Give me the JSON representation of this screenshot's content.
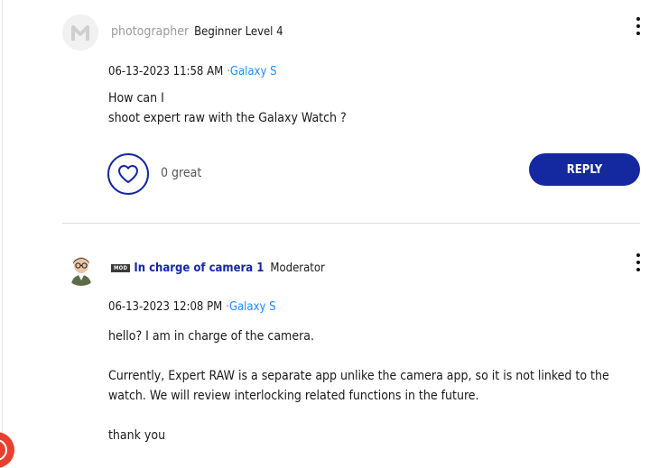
{
  "posts": [
    {
      "username": "photographer",
      "rank": "Beginner Level 4",
      "date": "06-13-2023 11:58 AM",
      "separator": "·",
      "board": "Galaxy S",
      "body": [
        "How can I",
        "shoot expert raw with the Galaxy Watch ?"
      ],
      "likes": "0 great",
      "reply_label": "REPLY",
      "avatar_initial": "M"
    },
    {
      "badge": "MOD",
      "username": "In charge of camera 1",
      "role": "Moderator",
      "date": "06-13-2023 12:08 PM",
      "separator": "·",
      "board": "Galaxy S",
      "body": [
        "hello? I am in charge of the camera.",
        "",
        "Currently, Expert RAW is a separate app unlike the camera app, so it is not linked to the watch. We will review interlocking related functions in the future.",
        "",
        "thank you"
      ]
    }
  ],
  "icons": {
    "kebab": "more-options-icon",
    "like": "heart-icon",
    "corner": "chat-widget-icon"
  },
  "colors": {
    "accent": "#1428a0",
    "link": "#2189ff",
    "muted_username": "#9b9b9b",
    "widget": "#e8402f"
  }
}
